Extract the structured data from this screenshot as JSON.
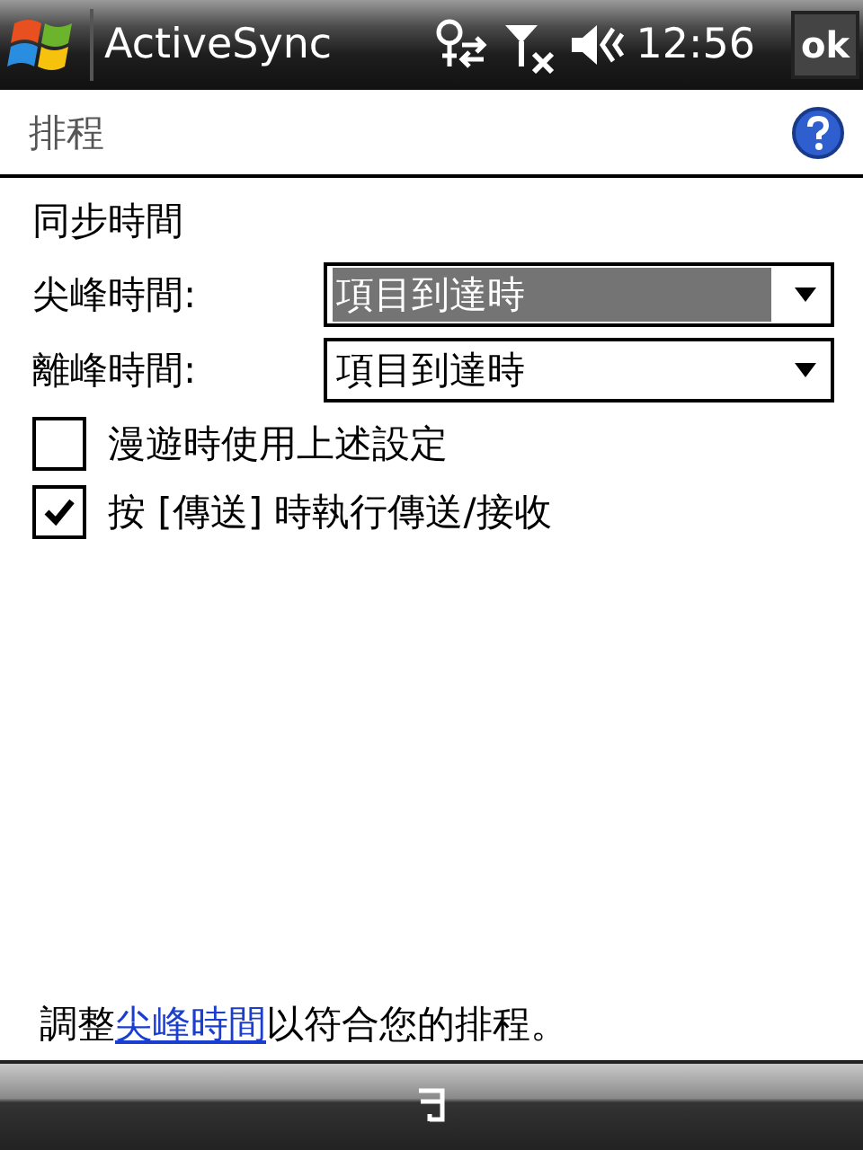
{
  "title_bar": {
    "app": "ActiveSync",
    "time": "12:56",
    "ok": "ok"
  },
  "header": {
    "title": "排程"
  },
  "section": "同步時間",
  "dropdowns": [
    {
      "label": "尖峰時間:",
      "value": "項目到達時",
      "selected": true
    },
    {
      "label": "離峰時間:",
      "value": "項目到達時",
      "selected": false
    }
  ],
  "checkboxes": [
    {
      "label": "漫遊時使用上述設定",
      "checked": false
    },
    {
      "label": "按 [傳送] 時執行傳送/接收",
      "checked": true
    }
  ],
  "footer_note": {
    "before": "調整",
    "link": "尖峰時間",
    "after": "以符合您的排程。"
  }
}
